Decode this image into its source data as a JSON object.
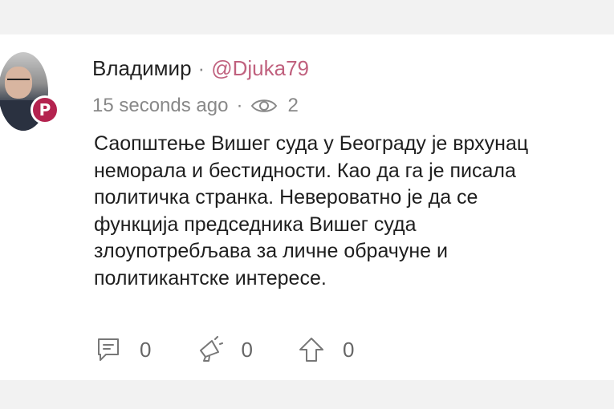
{
  "post": {
    "author_name": "Владимир",
    "separator": "·",
    "handle": "@Djuka79",
    "timestamp": "15 seconds ago",
    "views": "2",
    "body_lines": [
      "Саопштење Вишег суда у Београду је врхунац",
      "неморала и бестидности. Као да га је писала",
      "политичка странка. Невероватно је да се",
      "функција председника Вишег суда",
      "злоупотребљава за личне обрачуне и",
      "политикантске интересе."
    ],
    "badge_letter": "P",
    "actions": {
      "comments": "0",
      "echoes": "0",
      "upvotes": "0"
    }
  },
  "colors": {
    "handle": "#c0617e",
    "badge": "#b4234f",
    "muted": "#888888",
    "background": "#f2f2f2"
  }
}
